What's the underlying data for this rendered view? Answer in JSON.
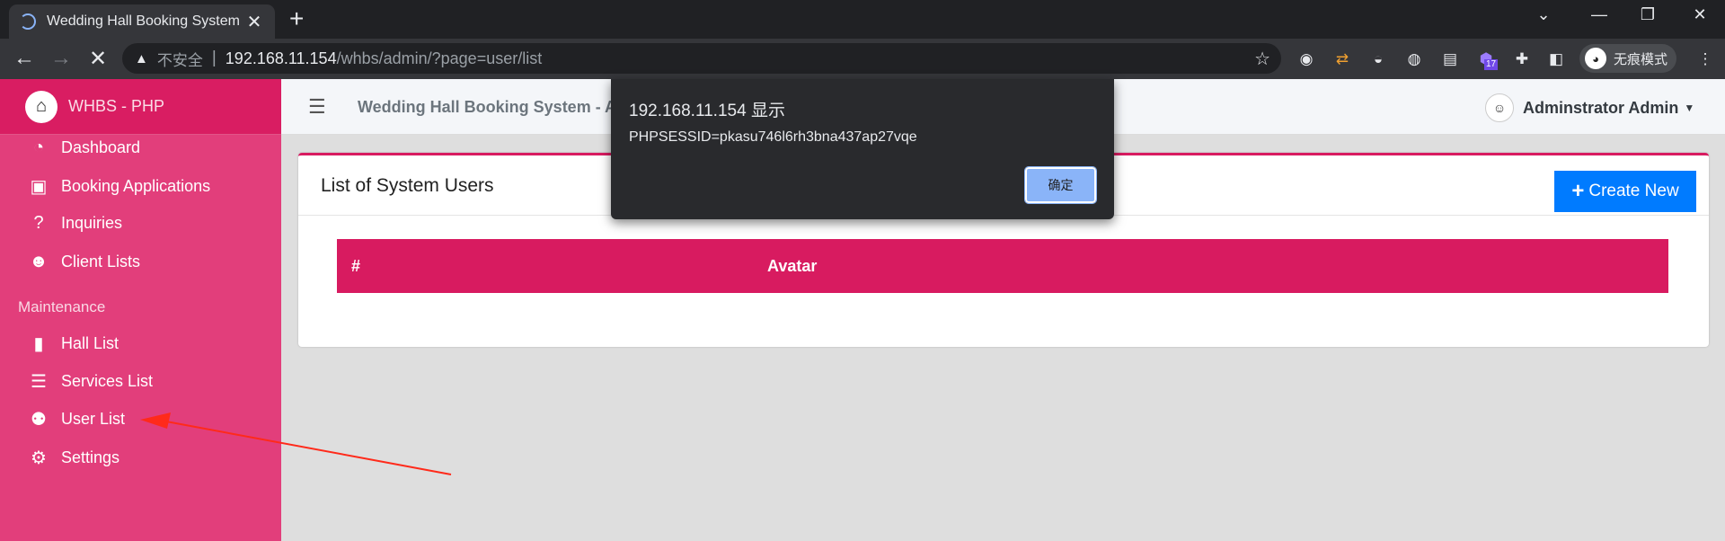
{
  "browser": {
    "tab_title": "Wedding Hall Booking System",
    "security_label": "不安全",
    "url_host": "192.168.11.154",
    "url_path": "/whbs/admin/?page=user/list",
    "extension_badge": "17",
    "incognito_label": "无痕模式"
  },
  "sidebar": {
    "brand": "WHBS - PHP",
    "items": [
      {
        "label": "Dashboard",
        "icon": "tachometer-icon"
      },
      {
        "label": "Booking Applications",
        "icon": "clipboard-icon"
      },
      {
        "label": "Inquiries",
        "icon": "question-circle-icon"
      },
      {
        "label": "Client Lists",
        "icon": "users-icon"
      }
    ],
    "maintenance_header": "Maintenance",
    "maintenance_items": [
      {
        "label": "Hall List",
        "icon": "door-icon"
      },
      {
        "label": "Services List",
        "icon": "list-icon"
      },
      {
        "label": "User List",
        "icon": "users-cog-icon"
      },
      {
        "label": "Settings",
        "icon": "cogs-icon"
      }
    ]
  },
  "header": {
    "title": "Wedding Hall Booking System - Ac",
    "user_name": "Adminstrator Admin"
  },
  "card": {
    "title": "List of System Users",
    "create_button": "Create New",
    "columns": [
      "#",
      "Avatar"
    ]
  },
  "dialog": {
    "title": "192.168.11.154 显示",
    "message": "PHPSESSID=pkasu746l6rh3bna437ap27vqe",
    "ok_label": "确定"
  },
  "colors": {
    "sidebar": "#e23e7b",
    "accent": "#d81b60",
    "primary_button": "#007bff",
    "annotation_arrow": "#ff2a1a"
  }
}
